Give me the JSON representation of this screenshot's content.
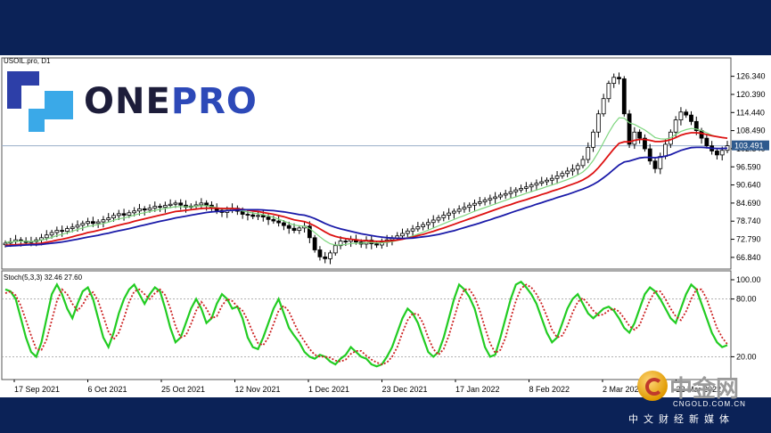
{
  "chart_data": [
    {
      "type": "candlestick",
      "symbol_label": "USOIL.pro, D1",
      "y_tick_labels": [
        "126.340",
        "120.390",
        "114.440",
        "108.490",
        "102.540",
        "96.590",
        "90.640",
        "84.690",
        "78.740",
        "72.790",
        "66.840"
      ],
      "ylim": [
        63.0,
        131.5
      ],
      "current_price_label": "103.491",
      "current_price": 103.49,
      "x_tick_labels": [
        "17 Sep 2021",
        "6 Oct 2021",
        "25 Oct 2021",
        "12 Nov 2021",
        "1 Dec 2021",
        "23 Dec 2021",
        "17 Jan 2022",
        "8 Feb 2022",
        "2 Mar 2022",
        "22 Mar 2022"
      ],
      "close": [
        71.5,
        72.0,
        72.6,
        72.2,
        71.7,
        72.0,
        72.6,
        73.3,
        74.2,
        75.0,
        75.7,
        75.4,
        76.3,
        76.8,
        77.4,
        78.0,
        78.6,
        78.0,
        78.5,
        79.2,
        79.8,
        80.6,
        81.2,
        80.7,
        81.5,
        82.1,
        82.8,
        82.4,
        83.0,
        83.6,
        83.3,
        83.9,
        84.3,
        84.7,
        84.0,
        83.3,
        83.7,
        84.1,
        84.7,
        84.0,
        83.0,
        82.3,
        81.6,
        82.3,
        83.0,
        82.0,
        81.0,
        80.8,
        80.3,
        80.6,
        80.1,
        79.3,
        78.8,
        78.2,
        77.3,
        76.4,
        75.7,
        76.5,
        77.1,
        73.3,
        69.3,
        67.0,
        66.4,
        68.3,
        70.7,
        72.2,
        72.1,
        72.7,
        71.9,
        71.2,
        72.5,
        71.3,
        70.9,
        71.8,
        72.6,
        73.2,
        73.9,
        74.7,
        75.5,
        76.2,
        76.9,
        77.6,
        78.3,
        79.1,
        79.9,
        80.7,
        81.4,
        82.0,
        82.7,
        83.3,
        84.0,
        84.6,
        85.1,
        85.7,
        86.2,
        86.7,
        87.3,
        87.8,
        88.4,
        89.0,
        89.5,
        90.0,
        90.6,
        91.2,
        91.7,
        92.2,
        92.8,
        93.6,
        94.4,
        95.2,
        95.8,
        97.0,
        99.0,
        103.0,
        108.0,
        114.0,
        119.0,
        124.0,
        126.0,
        125.5,
        114.0,
        104.0,
        108.0,
        106.0,
        102.5,
        98.5,
        96.0,
        100.0,
        104.0,
        108.0,
        112.0,
        114.6,
        113.6,
        111.5,
        108.5,
        106.0,
        103.5,
        101.8,
        100.5,
        102.0,
        103.5
      ],
      "series": [
        {
          "name": "",
          "color": "#7fd67f",
          "values": [
            71.8,
            71.9,
            72.1,
            72.2,
            72.1,
            72.1,
            72.2,
            72.5,
            72.9,
            73.4,
            74.0,
            74.4,
            74.9,
            75.4,
            76.0,
            76.5,
            77.0,
            77.3,
            77.6,
            78.0,
            78.4,
            79.0,
            79.5,
            79.8,
            80.2,
            80.7,
            81.2,
            81.5,
            81.9,
            82.3,
            82.6,
            82.9,
            83.2,
            83.5,
            83.5,
            83.5,
            83.5,
            83.6,
            83.8,
            83.8,
            83.5,
            83.2,
            82.8,
            82.7,
            82.7,
            82.5,
            82.1,
            81.8,
            81.4,
            81.2,
            80.9,
            80.5,
            80.0,
            79.4,
            78.8,
            78.1,
            77.5,
            77.2,
            77.1,
            76.3,
            75.0,
            73.6,
            72.3,
            71.3,
            70.9,
            70.9,
            71.1,
            71.4,
            71.5,
            71.5,
            71.7,
            71.7,
            71.6,
            71.6,
            71.8,
            72.0,
            72.4,
            72.8,
            73.4,
            73.9,
            74.5,
            75.1,
            75.8,
            76.5,
            77.2,
            77.9,
            78.6,
            79.3,
            80.0,
            80.6,
            81.3,
            82.0,
            82.6,
            83.2,
            83.8,
            84.4,
            85.0,
            85.6,
            86.2,
            86.7,
            87.3,
            87.9,
            88.4,
            89.0,
            89.5,
            90.1,
            90.6,
            91.2,
            91.8,
            92.4,
            93.1,
            93.9,
            94.9,
            96.5,
            98.7,
            101.5,
            104.6,
            107.8,
            110.6,
            112.7,
            112.6,
            111.0,
            110.5,
            109.6,
            108.7,
            107.5,
            106.2,
            105.8,
            105.7,
            106.1,
            107.2,
            108.2,
            108.8,
            109.2,
            109.0,
            108.5,
            107.8,
            107.0,
            106.5,
            106.2,
            106.0
          ]
        },
        {
          "name": "",
          "color": "#dd1111",
          "values": [
            70.8,
            70.9,
            71.0,
            71.1,
            71.1,
            71.2,
            71.3,
            71.5,
            71.8,
            72.1,
            72.5,
            72.8,
            73.2,
            73.6,
            74.1,
            74.5,
            75.0,
            75.3,
            75.7,
            76.1,
            76.5,
            77.0,
            77.4,
            77.8,
            78.2,
            78.7,
            79.1,
            79.5,
            79.9,
            80.3,
            80.7,
            81.1,
            81.5,
            81.9,
            82.1,
            82.3,
            82.5,
            82.7,
            82.9,
            83.0,
            83.0,
            83.0,
            82.9,
            82.9,
            82.9,
            82.8,
            82.6,
            82.4,
            82.1,
            81.9,
            81.6,
            81.3,
            81.0,
            80.6,
            80.2,
            79.7,
            79.2,
            78.9,
            78.6,
            78.0,
            77.2,
            76.2,
            75.2,
            74.3,
            73.7,
            73.3,
            73.0,
            72.8,
            72.6,
            72.4,
            72.3,
            72.2,
            72.1,
            72.1,
            72.2,
            72.3,
            72.5,
            72.8,
            73.2,
            73.5,
            74.0,
            74.4,
            74.9,
            75.4,
            76.0,
            76.5,
            77.1,
            77.7,
            78.3,
            78.9,
            79.5,
            80.1,
            80.7,
            81.3,
            81.9,
            82.5,
            83.1,
            83.7,
            84.2,
            84.8,
            85.3,
            85.8,
            86.4,
            86.9,
            87.5,
            88.0,
            88.6,
            89.1,
            89.7,
            90.3,
            90.9,
            91.5,
            92.3,
            93.3,
            94.6,
            96.3,
            98.3,
            100.4,
            102.5,
            104.3,
            104.8,
            104.8,
            105.3,
            105.6,
            105.6,
            105.3,
            104.9,
            104.9,
            105.1,
            105.5,
            106.2,
            107.0,
            107.5,
            107.8,
            107.8,
            107.6,
            107.2,
            106.8,
            106.5,
            106.2,
            106.0
          ]
        },
        {
          "name": "",
          "color": "#1a1aa8",
          "values": [
            70.5,
            70.6,
            70.7,
            70.8,
            70.9,
            71.0,
            71.0,
            71.1,
            71.3,
            71.5,
            71.7,
            71.9,
            72.2,
            72.5,
            72.8,
            73.2,
            73.5,
            73.8,
            74.1,
            74.5,
            74.8,
            75.2,
            75.6,
            75.9,
            76.3,
            76.7,
            77.1,
            77.5,
            77.9,
            78.3,
            78.7,
            79.0,
            79.4,
            79.8,
            80.1,
            80.4,
            80.7,
            81.0,
            81.3,
            81.6,
            81.8,
            81.9,
            82.0,
            82.2,
            82.3,
            82.4,
            82.5,
            82.5,
            82.5,
            82.5,
            82.4,
            82.3,
            82.2,
            82.0,
            81.8,
            81.5,
            81.2,
            80.9,
            80.7,
            80.2,
            79.6,
            78.8,
            78.0,
            77.3,
            76.7,
            76.2,
            75.8,
            75.4,
            75.0,
            74.6,
            74.3,
            74.0,
            73.7,
            73.5,
            73.3,
            73.2,
            73.1,
            73.1,
            73.1,
            73.2,
            73.4,
            73.6,
            73.8,
            74.1,
            74.4,
            74.8,
            75.2,
            75.6,
            76.1,
            76.6,
            77.1,
            77.6,
            78.1,
            78.7,
            79.2,
            79.8,
            80.3,
            80.9,
            81.5,
            82.1,
            82.6,
            83.2,
            83.7,
            84.3,
            84.8,
            85.4,
            85.9,
            86.5,
            87.0,
            87.5,
            88.1,
            88.7,
            89.3,
            90.0,
            90.8,
            91.8,
            93.0,
            94.3,
            95.8,
            97.2,
            98.2,
            98.5,
            99.0,
            99.5,
            99.7,
            99.7,
            99.6,
            99.8,
            100.1,
            100.6,
            101.3,
            102.0,
            102.5,
            102.9,
            103.0,
            103.0,
            102.9,
            102.7,
            102.6,
            102.6,
            102.7
          ]
        }
      ]
    },
    {
      "type": "line",
      "indicator_label": "Stoch(5,3,3) 32.46 27.60",
      "y_tick_labels": [
        "100.00",
        "80.00",
        "20.00"
      ],
      "ylim": [
        0,
        100
      ],
      "series": [
        {
          "name": "",
          "color": "#22cc22",
          "values": [
            90,
            88,
            80,
            60,
            40,
            25,
            20,
            35,
            60,
            85,
            95,
            85,
            70,
            60,
            75,
            88,
            92,
            80,
            60,
            40,
            30,
            45,
            65,
            80,
            90,
            95,
            85,
            75,
            85,
            92,
            88,
            70,
            50,
            35,
            40,
            55,
            70,
            80,
            70,
            55,
            60,
            75,
            85,
            80,
            70,
            72,
            60,
            40,
            30,
            28,
            40,
            55,
            70,
            80,
            65,
            50,
            42,
            35,
            25,
            20,
            18,
            22,
            20,
            15,
            12,
            18,
            22,
            30,
            25,
            20,
            18,
            12,
            10,
            12,
            20,
            30,
            45,
            60,
            70,
            65,
            55,
            40,
            25,
            20,
            25,
            40,
            60,
            80,
            95,
            90,
            82,
            70,
            50,
            30,
            20,
            22,
            40,
            60,
            80,
            95,
            98,
            92,
            85,
            75,
            60,
            45,
            35,
            40,
            55,
            70,
            80,
            85,
            75,
            65,
            60,
            65,
            70,
            72,
            68,
            60,
            50,
            45,
            55,
            70,
            85,
            92,
            88,
            80,
            70,
            60,
            55,
            70,
            85,
            95,
            90,
            75,
            60,
            45,
            35,
            30,
            32
          ]
        },
        {
          "name": "",
          "color": "#cc2222",
          "values": [
            86,
            88,
            84,
            73,
            58,
            42,
            28,
            27,
            38,
            58,
            78,
            90,
            85,
            75,
            68,
            74,
            84,
            87,
            78,
            62,
            46,
            38,
            45,
            60,
            77,
            88,
            90,
            85,
            80,
            86,
            90,
            84,
            70,
            52,
            40,
            42,
            54,
            68,
            77,
            70,
            60,
            62,
            73,
            80,
            78,
            72,
            68,
            58,
            45,
            34,
            32,
            40,
            54,
            68,
            73,
            67,
            55,
            44,
            36,
            28,
            22,
            20,
            20,
            19,
            16,
            15,
            17,
            23,
            26,
            26,
            21,
            17,
            14,
            12,
            14,
            20,
            30,
            45,
            58,
            65,
            64,
            55,
            40,
            28,
            22,
            28,
            42,
            60,
            78,
            90,
            90,
            82,
            68,
            50,
            34,
            24,
            27,
            40,
            60,
            78,
            91,
            95,
            92,
            85,
            75,
            62,
            48,
            40,
            42,
            52,
            66,
            77,
            81,
            75,
            68,
            63,
            64,
            68,
            70,
            67,
            60,
            52,
            48,
            53,
            66,
            79,
            88,
            88,
            80,
            70,
            62,
            58,
            67,
            80,
            90,
            90,
            80,
            65,
            50,
            40,
            33
          ]
        }
      ]
    }
  ],
  "brand": {
    "part1": "ONE",
    "part2": "PRO"
  },
  "watermark": {
    "cn": "中金网",
    "url": "CNGOLD.COM.CN",
    "sub": "中文财经新媒体"
  },
  "colors": {
    "frame": "#0b2257",
    "bull": "#ffffff",
    "bear": "#000000",
    "price_line": "#9aaec8"
  }
}
